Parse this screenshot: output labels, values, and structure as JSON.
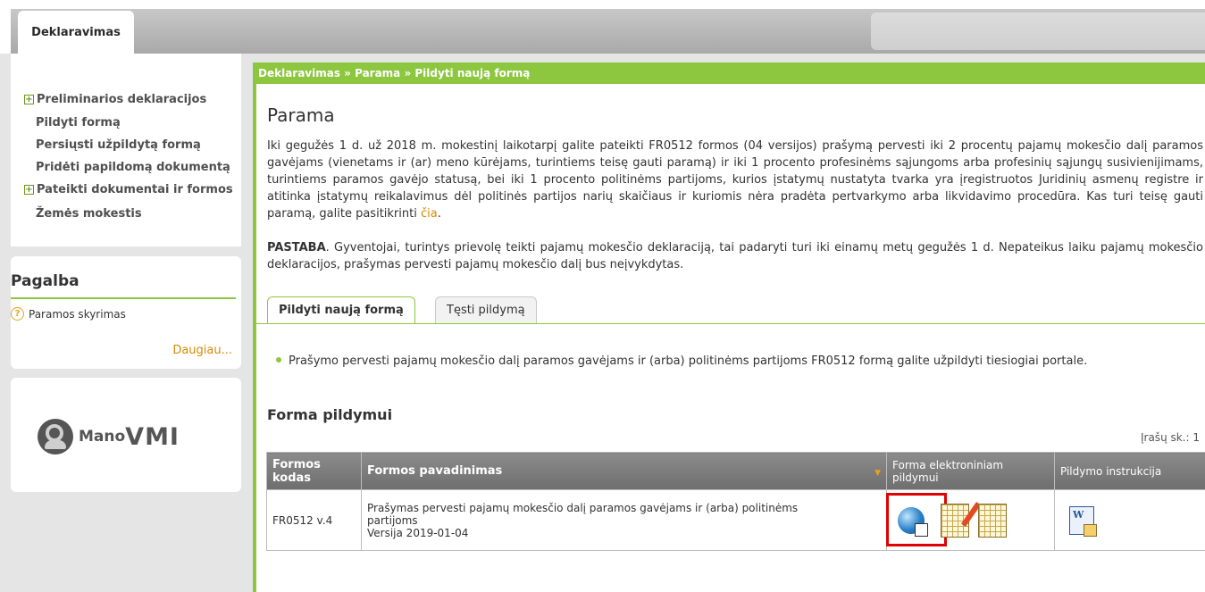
{
  "header": {
    "tab_label": "Deklaravimas"
  },
  "sidebar": {
    "items": [
      {
        "label": "Preliminarios deklaracijos",
        "expandable": true
      },
      {
        "label": "Pildyti formą",
        "expandable": false
      },
      {
        "label": "Persiųsti užpildytą formą",
        "expandable": false
      },
      {
        "label": "Pridėti papildomą dokumentą",
        "expandable": false
      },
      {
        "label": "Pateikti dokumentai ir formos",
        "expandable": true
      },
      {
        "label": "Žemės mokestis",
        "expandable": false
      }
    ]
  },
  "help": {
    "title": "Pagalba",
    "item": "Paramos skyrimas",
    "more": "Daugiau..."
  },
  "logo": {
    "text1": "Mano",
    "text2": "VMI"
  },
  "main": {
    "breadcrumb": "Deklaravimas » Parama » Pildyti naują formą",
    "title": "Parama",
    "intro": "Iki gegužės 1 d. už 2018 m. mokestinį laikotarpį galite pateikti FR0512 formos (04 versijos) prašymą pervesti iki 2 procentų pajamų mokesčio dalį paramos gavėjams (vienetams ir (ar) meno kūrėjams, turintiems teisę gauti paramą) ir iki 1 procento profesinėms sąjungoms arba profesinių sąjungų susivienijimams, turintiems paramos gavėjo statusą, bei iki 1 procento politinėms partijoms, kurios įstatymų nustatyta tvarka yra įregistruotos Juridinių asmenų registre ir atitinka įstatymų reikalavimus dėl politinės partijos narių skaičiaus ir kuriomis nėra pradėta pertvarkymo arba likvidavimo procedūra. Kas turi teisę gauti paramą, galite pasitikrinti ",
    "intro_link": "čia",
    "intro_end": ".",
    "note_label": "PASTABA",
    "note_text": ". Gyventojai, turintys prievolę teikti pajamų mokesčio deklaraciją, tai padaryti turi iki einamų metų gegužės 1 d. Nepateikus laiku pajamų mokesčio deklaracijos, prašymas pervesti pajamų mokesčio dalį bus neįvykdytas.",
    "tabs": [
      {
        "label": "Pildyti naują formą",
        "active": true
      },
      {
        "label": "Tęsti pildymą",
        "active": false
      }
    ],
    "bullet": "Prašymo pervesti pajamų mokesčio dalį paramos gavėjams ir (arba) politinėms partijoms FR0512 formą galite užpildyti tiesiogiai portale.",
    "section_title": "Forma pildymui",
    "record_count": "Įrašų sk.: 1",
    "table": {
      "headers": [
        "Formos kodas",
        "Formos pavadinimas",
        "Forma elektroniniam pildymui",
        "Pildymo instrukcija"
      ],
      "rows": [
        {
          "code": "FR0512 v.4",
          "name_line1": "Prašymas pervesti pajamų mokesčio dalį paramos gavėjams ir (arba) politinėms",
          "name_line2": "partijoms",
          "version": "Versija 2019-01-04"
        }
      ]
    }
  },
  "colors": {
    "accent_green": "#8dc63f",
    "link_orange": "#d48a00",
    "highlight_red": "#e00000",
    "table_header": "#7a7a7a"
  },
  "icons": [
    "globe-edit-icon",
    "sheet-edit-icon",
    "sheet-icon",
    "word-doc-icon",
    "help-question-icon",
    "plus-expand-icon",
    "sort-arrow-icon",
    "mano-vmi-logo"
  ]
}
